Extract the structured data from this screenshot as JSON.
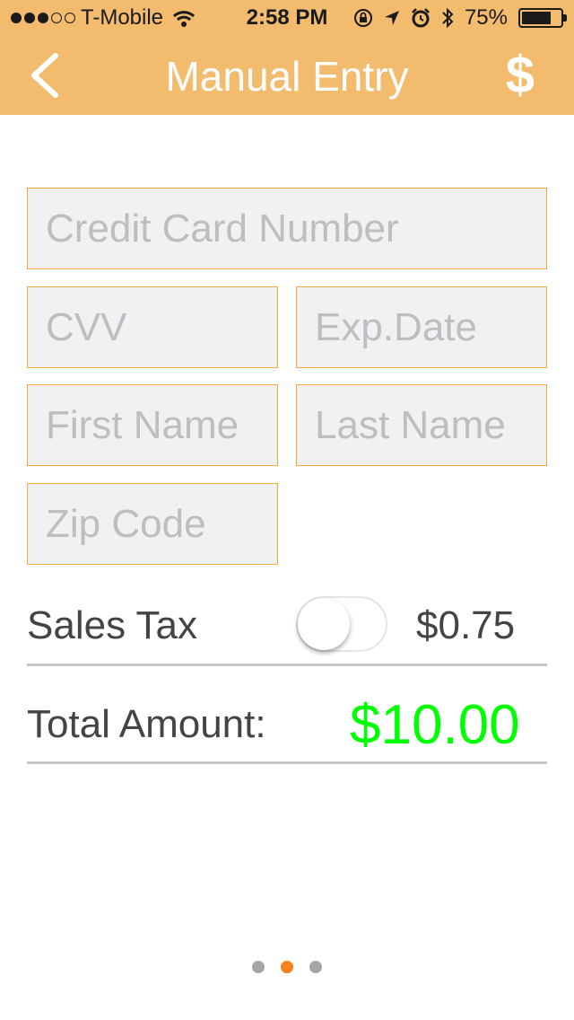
{
  "status_bar": {
    "carrier": "T-Mobile",
    "time": "2:58 PM",
    "battery": "75%",
    "battery_level": 0.75
  },
  "header": {
    "title": "Manual Entry",
    "action_label": "$"
  },
  "form": {
    "card_number_placeholder": "Credit Card Number",
    "cvv_placeholder": "CVV",
    "exp_date_placeholder": "Exp.Date",
    "first_name_placeholder": "First Name",
    "last_name_placeholder": "Last Name",
    "zip_placeholder": "Zip Code"
  },
  "summary": {
    "sales_tax_label": "Sales Tax",
    "sales_tax_enabled": false,
    "sales_tax_value": "$0.75",
    "total_label": "Total Amount:",
    "total_value": "$10.00"
  },
  "pager": {
    "pages": 3,
    "current": 2
  },
  "colors": {
    "header_bg": "#f3bb6e",
    "field_border": "#f3a940",
    "total_green": "#00ff00",
    "pager_active": "#f5821f"
  },
  "icons": [
    "signal-dots-icon",
    "wifi-icon",
    "lock-rotation-icon",
    "location-arrow-icon",
    "alarm-icon",
    "bluetooth-icon",
    "battery-icon",
    "back-chevron-icon"
  ]
}
